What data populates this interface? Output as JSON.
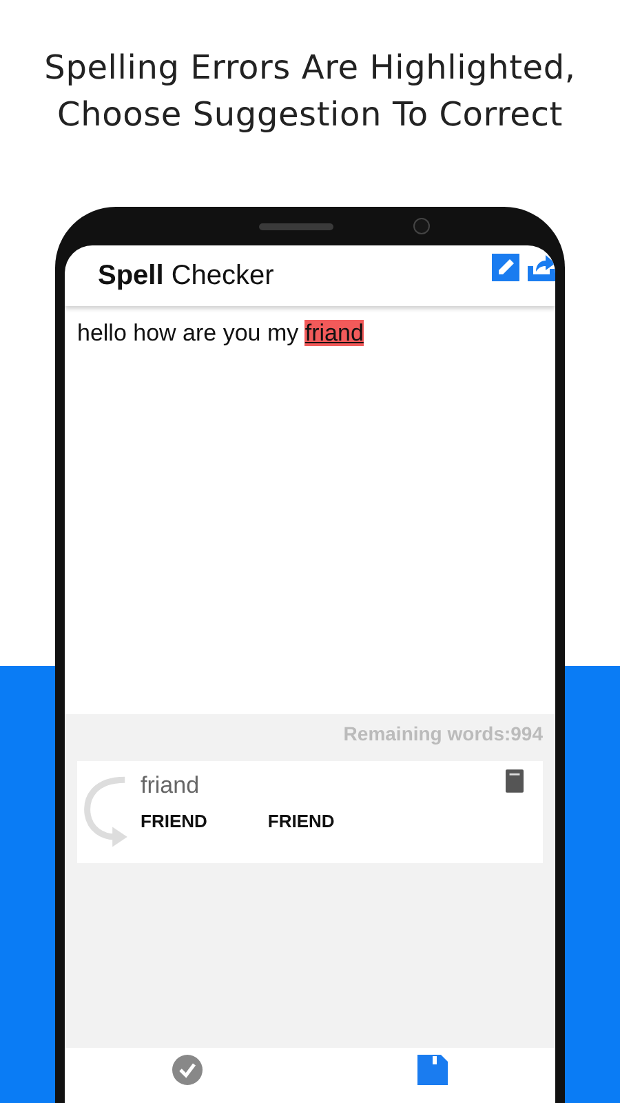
{
  "headline": [
    "Spelling Errors Are Highlighted,",
    "Choose Suggestion To Correct"
  ],
  "app_bar": {
    "title": "**Spell** Checker",
    "actions": [
      {
        "kind": "edit"
      },
      {
        "kind": "export"
      }
    ]
  },
  "editor": {
    "text_before": "hello how are you my ",
    "error_word": "friand",
    "highlighted": true
  },
  "remaining": "Remaining words:994",
  "suggestion_card": {
    "word": "friand",
    "suggestions": [
      "FRIEND",
      "FRIEND"
    ]
  },
  "bottom_nav": [
    {
      "kind": "check",
      "selected": false
    },
    {
      "kind": "save",
      "selected": true
    }
  ]
}
